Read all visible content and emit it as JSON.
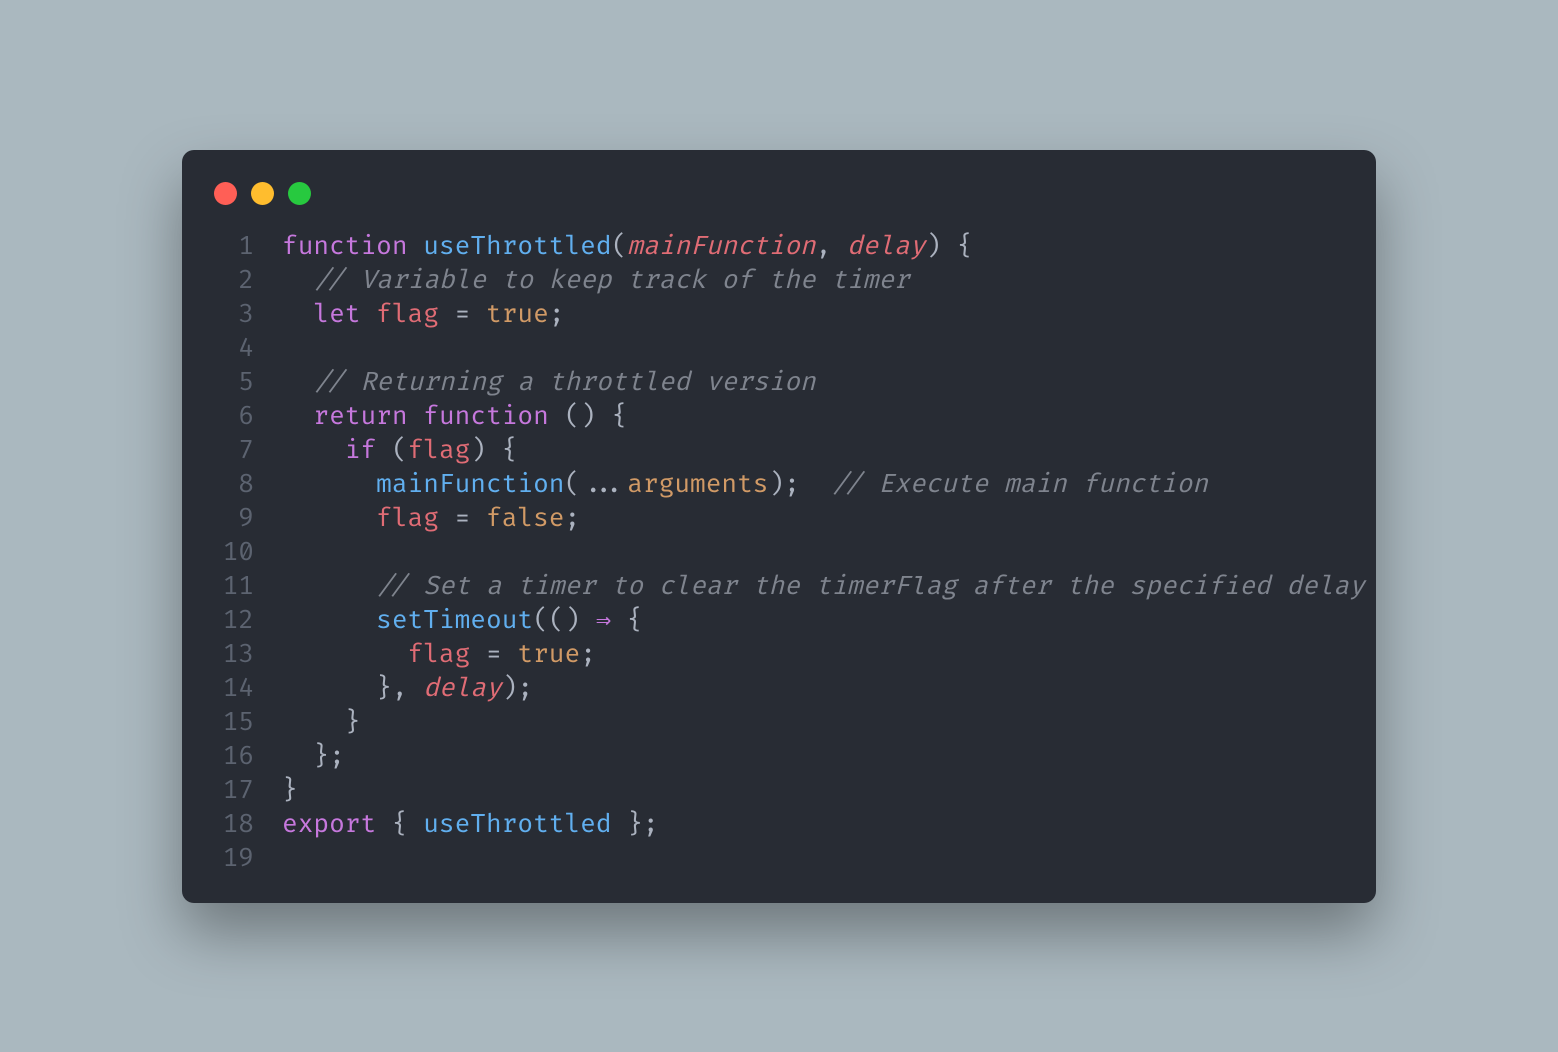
{
  "window": {
    "dots": [
      "red",
      "yellow",
      "green"
    ]
  },
  "code": {
    "lines": [
      {
        "n": "1",
        "tokens": [
          {
            "t": "function",
            "c": "kw"
          },
          {
            "t": " ",
            "c": "p"
          },
          {
            "t": "useThrottled",
            "c": "fn"
          },
          {
            "t": "(",
            "c": "p"
          },
          {
            "t": "mainFunction",
            "c": "prm"
          },
          {
            "t": ", ",
            "c": "p"
          },
          {
            "t": "delay",
            "c": "prm"
          },
          {
            "t": ") {",
            "c": "p"
          }
        ]
      },
      {
        "n": "2",
        "tokens": [
          {
            "t": "  ",
            "c": "p"
          },
          {
            "t": "// Variable to keep track of the timer",
            "c": "cm"
          }
        ]
      },
      {
        "n": "3",
        "tokens": [
          {
            "t": "  ",
            "c": "p"
          },
          {
            "t": "let",
            "c": "kw"
          },
          {
            "t": " ",
            "c": "p"
          },
          {
            "t": "flag",
            "c": "var"
          },
          {
            "t": " = ",
            "c": "p"
          },
          {
            "t": "true",
            "c": "bool"
          },
          {
            "t": ";",
            "c": "p"
          }
        ]
      },
      {
        "n": "4",
        "tokens": [
          {
            "t": "",
            "c": "p"
          }
        ]
      },
      {
        "n": "5",
        "tokens": [
          {
            "t": "  ",
            "c": "p"
          },
          {
            "t": "// Returning a throttled version",
            "c": "cm"
          }
        ]
      },
      {
        "n": "6",
        "tokens": [
          {
            "t": "  ",
            "c": "p"
          },
          {
            "t": "return",
            "c": "kw"
          },
          {
            "t": " ",
            "c": "p"
          },
          {
            "t": "function",
            "c": "kw"
          },
          {
            "t": " () {",
            "c": "p"
          }
        ]
      },
      {
        "n": "7",
        "tokens": [
          {
            "t": "    ",
            "c": "p"
          },
          {
            "t": "if",
            "c": "kw"
          },
          {
            "t": " (",
            "c": "p"
          },
          {
            "t": "flag",
            "c": "var"
          },
          {
            "t": ") {",
            "c": "p"
          }
        ]
      },
      {
        "n": "8",
        "tokens": [
          {
            "t": "      ",
            "c": "p"
          },
          {
            "t": "mainFunction",
            "c": "fn"
          },
          {
            "t": "(...",
            "c": "p"
          },
          {
            "t": "arguments",
            "c": "prop"
          },
          {
            "t": ");  ",
            "c": "p"
          },
          {
            "t": "// Execute main function",
            "c": "cm"
          }
        ]
      },
      {
        "n": "9",
        "tokens": [
          {
            "t": "      ",
            "c": "p"
          },
          {
            "t": "flag",
            "c": "var"
          },
          {
            "t": " = ",
            "c": "p"
          },
          {
            "t": "false",
            "c": "bool"
          },
          {
            "t": ";",
            "c": "p"
          }
        ]
      },
      {
        "n": "10",
        "tokens": [
          {
            "t": "",
            "c": "p"
          }
        ]
      },
      {
        "n": "11",
        "tokens": [
          {
            "t": "      ",
            "c": "p"
          },
          {
            "t": "// Set a timer to clear the timerFlag after the specified delay",
            "c": "cm"
          }
        ]
      },
      {
        "n": "12",
        "tokens": [
          {
            "t": "      ",
            "c": "p"
          },
          {
            "t": "setTimeout",
            "c": "fn"
          },
          {
            "t": "(() ",
            "c": "p"
          },
          {
            "t": "⇒",
            "c": "kw"
          },
          {
            "t": " {",
            "c": "p"
          }
        ]
      },
      {
        "n": "13",
        "tokens": [
          {
            "t": "        ",
            "c": "p"
          },
          {
            "t": "flag",
            "c": "var"
          },
          {
            "t": " = ",
            "c": "p"
          },
          {
            "t": "true",
            "c": "bool"
          },
          {
            "t": ";",
            "c": "p"
          }
        ]
      },
      {
        "n": "14",
        "tokens": [
          {
            "t": "      }, ",
            "c": "p"
          },
          {
            "t": "delay",
            "c": "prm"
          },
          {
            "t": ");",
            "c": "p"
          }
        ]
      },
      {
        "n": "15",
        "tokens": [
          {
            "t": "    }",
            "c": "p"
          }
        ]
      },
      {
        "n": "16",
        "tokens": [
          {
            "t": "  };",
            "c": "p"
          }
        ]
      },
      {
        "n": "17",
        "tokens": [
          {
            "t": "}",
            "c": "p"
          }
        ]
      },
      {
        "n": "18",
        "tokens": [
          {
            "t": "export",
            "c": "kw"
          },
          {
            "t": " { ",
            "c": "p"
          },
          {
            "t": "useThrottled",
            "c": "fn"
          },
          {
            "t": " };",
            "c": "p"
          }
        ]
      },
      {
        "n": "19",
        "tokens": [
          {
            "t": "",
            "c": "p"
          }
        ]
      }
    ]
  }
}
